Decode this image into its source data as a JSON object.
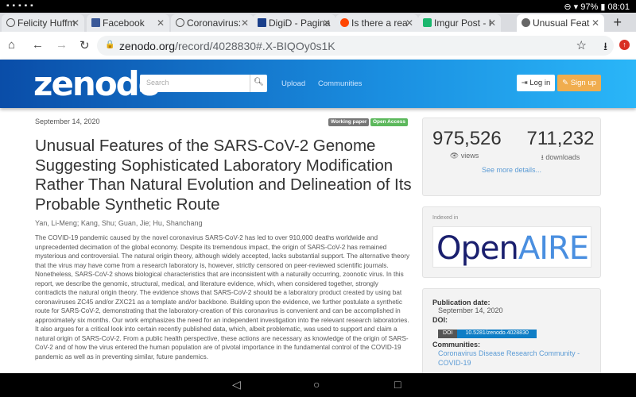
{
  "status": {
    "battery": "97%",
    "time": "08:01"
  },
  "tabs": [
    {
      "label": "Felicity Huffm",
      "icon": "compass-icon",
      "color": "#555"
    },
    {
      "label": "Facebook",
      "icon": "facebook-icon",
      "color": "#3b5998"
    },
    {
      "label": "Coronavirus:",
      "icon": "compass-icon",
      "color": "#555"
    },
    {
      "label": "DigiD - Pagina",
      "icon": "digid-icon",
      "color": "#1a3f8a"
    },
    {
      "label": "Is there a rea",
      "icon": "reddit-icon",
      "color": "#ff4500"
    },
    {
      "label": "Imgur Post - I",
      "icon": "imgur-icon",
      "color": "#1bb76e"
    },
    {
      "label": "Unusual Feat",
      "icon": "globe-icon",
      "color": "#555"
    }
  ],
  "url": {
    "domain": "zenodo.org",
    "path": "/record/4028830#.X-BIQOy0s1K"
  },
  "header": {
    "logo": "zenodo",
    "search_placeholder": "Search",
    "upload": "Upload",
    "communities": "Communities",
    "login": "Log in",
    "signup": "Sign up"
  },
  "record": {
    "date": "September 14, 2020",
    "badges": [
      {
        "label": "Working paper",
        "color": "#777"
      },
      {
        "label": "Open Access",
        "color": "#5cb85c"
      }
    ],
    "title": "Unusual Features of the SARS-CoV-2 Genome Suggesting Sophisticated Laboratory Modification Rather Than Natural Evolution and Delineation of Its Probable Synthetic Route",
    "authors": "Yan, Li-Meng; Kang, Shu; Guan, Jie; Hu, Shanchang",
    "abstract": "The COVID-19 pandemic caused by the novel coronavirus SARS-CoV-2 has led to over 910,000 deaths worldwide and unprecedented decimation of the global economy. Despite its tremendous impact, the origin of SARS-CoV-2 has remained mysterious and controversial. The natural origin theory, although widely accepted, lacks substantial support. The alternative theory that the virus may have come from a research laboratory is, however, strictly censored on peer-reviewed scientific journals. Nonetheless, SARS-CoV-2 shows biological characteristics that are inconsistent with a naturally occurring, zoonotic virus. In this report, we describe the genomic, structural, medical, and literature evidence, which, when considered together, strongly contradicts the natural origin theory. The evidence shows that SARS-CoV-2 should be a laboratory product created by using bat coronaviruses ZC45 and/or ZXC21 as a template and/or backbone. Building upon the evidence, we further postulate a synthetic route for SARS-CoV-2, demonstrating that the laboratory-creation of this coronavirus is convenient and can be accomplished in approximately six months. Our work emphasizes the need for an independent investigation into the relevant research laboratories. It also argues for a critical look into certain recently published data, which, albeit problematic, was used to support and claim a natural origin of SARS-CoV-2. From a public health perspective, these actions are necessary as knowledge of the origin of SARS-CoV-2 and of how the virus entered the human population are of pivotal importance in the fundamental control of the COVID-19 pandemic as well as in preventing similar, future pandemics."
  },
  "stats": {
    "views": "975,526",
    "views_label": "views",
    "downloads": "711,232",
    "downloads_label": "downloads",
    "more": "See more details..."
  },
  "indexed": {
    "label": "Indexed in",
    "logo_a": "Open",
    "logo_b": "AIRE"
  },
  "meta": {
    "pub_label": "Publication date:",
    "pub_value": "September 14, 2020",
    "doi_label": "DOI:",
    "doi_tag": "DOI",
    "doi_value": "10.5281/zenodo.4028830",
    "communities_label": "Communities:",
    "community": "Coronavirus Disease Research Community - COVID-19"
  }
}
